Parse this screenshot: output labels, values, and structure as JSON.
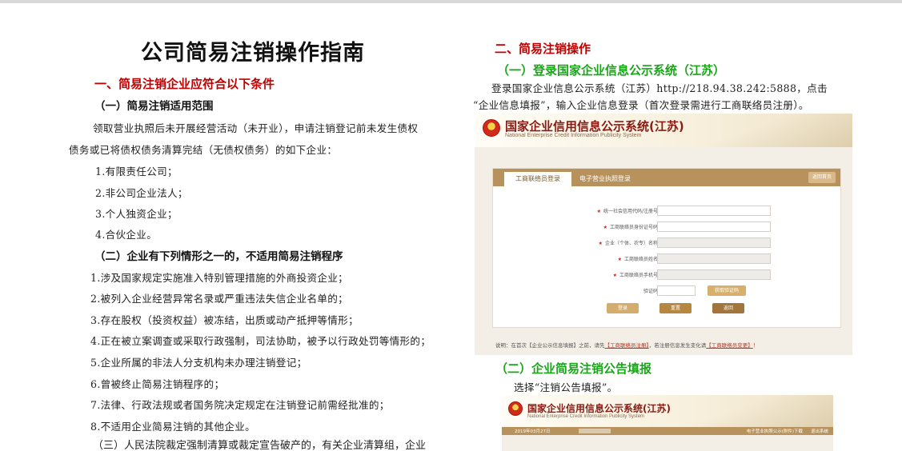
{
  "left": {
    "title": "公司简易注销操作指南",
    "section1": "一、简易注销企业应符合以下条件",
    "sub1": "（一）简易注销适用范围",
    "para1_line1": "领取营业执照后未开展经营活动（未开业），申请注销登记前未发生债权",
    "para1_line2": "债务或已将债权债务清算完结（无债权债务）的如下企业：",
    "list1": [
      "1.有限责任公司；",
      "2.非公司企业法人；",
      "3.个人独资企业；",
      "4.合伙企业。"
    ],
    "sub2": "（二）企业有下列情形之一的，不适用简易注销程序",
    "list2": [
      "1.涉及国家规定实施准入特别管理措施的外商投资企业；",
      "2.被列入企业经营异常名录或严重违法失信企业名单的；",
      "3.存在股权（投资权益）被冻结，出质或动产抵押等情形；",
      "4.正在被立案调查或采取行政强制，司法协助，被予以行政处罚等情形的；",
      "5.企业所属的非法人分支机构未办理注销登记；",
      "6.曾被终止简易注销程序的；",
      "7.法律、行政法规或者国务院决定规定在注销登记前需经批准的；",
      "8.不适用企业简易注销的其他企业。"
    ],
    "sub3": "（三）人民法院裁定强制清算或裁定宣告破产的，有关企业清算组，企业"
  },
  "right": {
    "section2": "二、简易注销操作",
    "step1": "（一）登录国家企业信息公示系统（江苏）",
    "step1_line1": "登录国家企业信息公示系统（江苏）http://218.94.38.242:5888，点击",
    "step1_line2": "“企业信息填报”，输入企业信息登录（首次登录需进行工商联络员注册）。",
    "step2": "（二）企业简易注销公告填报",
    "step2_line1": "选择“注销公告填报”。"
  },
  "shot1": {
    "site_title": "国家企业信用信息公示系统(江苏)",
    "site_subtitle": "National Enterprise Credit Information Publicity System",
    "tab_active": "工商联络员登录",
    "tab_other": "电子营业执照登录",
    "back_home": "返回首页",
    "fields": [
      {
        "label": "统一社会信用代码/注册号",
        "required": true,
        "grey": false
      },
      {
        "label": "工商联络员身份证号码",
        "required": true,
        "grey": false
      },
      {
        "label": "企业（个体、农专）名称",
        "required": true,
        "grey": true
      },
      {
        "label": "工商联络员姓名",
        "required": true,
        "grey": true
      },
      {
        "label": "工商联络员手机号",
        "required": true,
        "grey": true
      }
    ],
    "captcha_label": "验证码",
    "get_code_button": "获取验证码",
    "login_button": "登录",
    "reset_button": "重置",
    "return_button": "返回",
    "note_pre": "说明：在首次【企业公示信息填报】之前，请先",
    "note_link1": "【工商联络员注册】",
    "note_mid": "，若注册信息发生变化请",
    "note_link2": "【工商联络员变更】",
    "note_end": "！",
    "colors": {
      "accent": "#b7925d",
      "brand_red": "#8a1a12"
    }
  },
  "shot2": {
    "site_title": "国家企业信用信息公示系统(江苏)",
    "site_subtitle": "National Enterprise Credit Information Publicity System",
    "date": "2019年03月27日",
    "right_link": "电子营业执照公示(附件)下载",
    "exit_link": "退出系统"
  },
  "colors": {
    "section_red": "#c00000",
    "step_green": "#1aa51a"
  }
}
